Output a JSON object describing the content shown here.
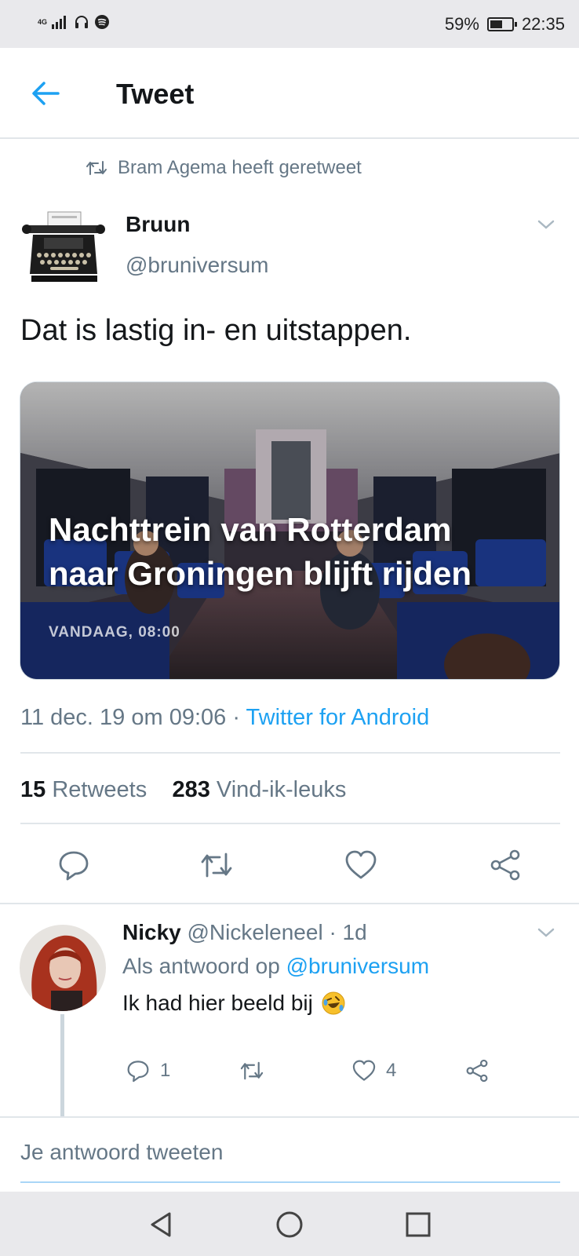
{
  "status_bar": {
    "network": "4G",
    "battery": "59%",
    "battery_level": 0.59,
    "time": "22:35"
  },
  "header": {
    "title": "Tweet"
  },
  "retweet_banner": {
    "text": "Bram Agema heeft geretweet"
  },
  "tweet": {
    "author_name": "Bruun",
    "author_handle": "@bruniversum",
    "text": "Dat is lastig in- en uitstappen.",
    "media": {
      "headline_line1": "Nachttrein van Rotterdam",
      "headline_line2": "naar Groningen blijft rijden",
      "timestamp": "VANDAAG, 08:00"
    },
    "date": "11 dec. 19 om 09:06",
    "separator": " · ",
    "source": "Twitter for Android",
    "retweets_count": "15",
    "retweets_label": "Retweets",
    "likes_count": "283",
    "likes_label": "Vind-ik-leuks"
  },
  "reply": {
    "name": "Nicky",
    "handle": "@Nickeleneel",
    "age": "· 1d",
    "reply_to_prefix": "Als antwoord op",
    "reply_to_handle": "@bruniversum",
    "text": "Ik had hier beeld bij",
    "reply_count": "1",
    "like_count": "4"
  },
  "compose": {
    "placeholder": "Je antwoord tweeten"
  },
  "colors": {
    "accent": "#1da1f2",
    "muted": "#657786",
    "text": "#14171a",
    "divider": "#e1e6ea"
  }
}
